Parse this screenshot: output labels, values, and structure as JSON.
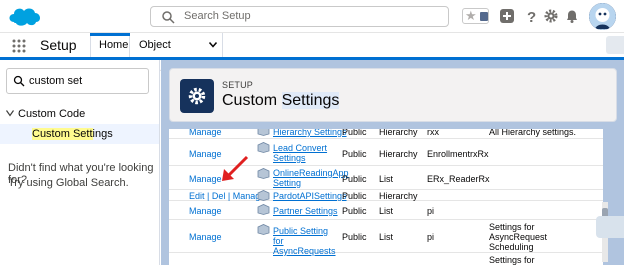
{
  "header": {
    "search_placeholder": "Search Setup",
    "favorites_star_icon": "star-icon",
    "icons": [
      "add-icon",
      "help-icon",
      "gear-icon",
      "bell-icon",
      "avatar"
    ]
  },
  "nav": {
    "app_name": "Setup",
    "tabs": [
      {
        "label": "Home",
        "active": true
      },
      {
        "label": "Object Manager",
        "active": false
      }
    ]
  },
  "sidebar": {
    "quick_find_value": "custom set",
    "tree": {
      "parent_label": "Custom Code",
      "child_label_prefix": "Custom Sett",
      "child_label_suffix": "ings"
    },
    "not_found_line1": "Didn't find what you're looking for?",
    "not_found_line2": "Try using Global Search."
  },
  "page_header": {
    "eyebrow": "SETUP",
    "title_prefix": "Custom ",
    "title_highlight": "Settings"
  },
  "table": {
    "rows": [
      {
        "action": "Manage",
        "label": "Hierarchy Settings",
        "visibility": "Public",
        "type": "Hierarchy",
        "namespace": "rxx",
        "description": "All Hierarchy settings."
      },
      {
        "action": "Manage",
        "label": "Lead Convert Settings",
        "visibility": "Public",
        "type": "Hierarchy",
        "namespace": "EnrollmentrxRx",
        "description": ""
      },
      {
        "action": "Manage",
        "label": "OnlineReadingApp Setting",
        "visibility": "Public",
        "type": "List",
        "namespace": "ERx_ReaderRx",
        "description": ""
      },
      {
        "action": "Edit | Del | Manage",
        "label": "PardotAPISettings",
        "visibility": "Public",
        "type": "Hierarchy",
        "namespace": "",
        "description": ""
      },
      {
        "action": "Manage",
        "label": "Partner Settings",
        "visibility": "Public",
        "type": "List",
        "namespace": "pi",
        "description": ""
      },
      {
        "action": "Manage",
        "label": "Public Setting for AsyncRequests",
        "visibility": "Public",
        "type": "List",
        "namespace": "pi",
        "description": "Settings for AsyncRequest Scheduling"
      },
      {
        "action": "",
        "label": "",
        "visibility": "",
        "type": "",
        "namespace": "",
        "description": "Settings for"
      }
    ]
  },
  "colors": {
    "brand_blue": "#0070d2",
    "nav_dark": "#16325c",
    "main_bg": "#b0c4df",
    "highlight": "#fffb8f",
    "arrow_red": "#e02020"
  }
}
